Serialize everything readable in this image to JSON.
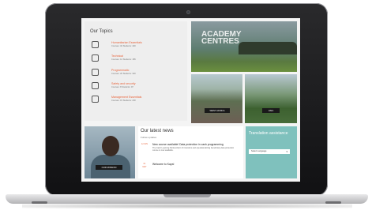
{
  "topics": {
    "heading": "Our Topics",
    "items": [
      {
        "icon": "tools-icon",
        "title": "Humanitarian Essentials",
        "stats": "Courses: 32  Students: 430"
      },
      {
        "icon": "wrench-icon",
        "title": "Technical",
        "stats": "Courses: 12  Students: 185"
      },
      {
        "icon": "hand-icon",
        "title": "Programmatic",
        "stats": "Courses: 20  Students: 320"
      },
      {
        "icon": "shield-icon",
        "title": "Safety and security",
        "stats": "Courses: 8  Students: 97"
      },
      {
        "icon": "briefcase-icon",
        "title": "Management Essentials",
        "stats": "Courses: 15  Students: 200"
      }
    ]
  },
  "academy": {
    "title": "ACADEMY CENTRES"
  },
  "photos": {
    "button1": "WEST AFRICA",
    "button2": "ASIA"
  },
  "person": {
    "button": "OUR MISSION"
  },
  "news": {
    "heading": "Our latest news",
    "follow": "Follow updates",
    "items": [
      {
        "date": "12 JUN",
        "title": "New course available! Data protection in cash programming",
        "body": "The Cash Learning Partnership's IC transfers and operationalizing beneficiary data protection course is now available."
      },
      {
        "date": "01 MAY",
        "title": "Welcome to Kaya!",
        "body": ""
      }
    ]
  },
  "translate": {
    "title": "Translation assistance",
    "select": "Select Language"
  }
}
